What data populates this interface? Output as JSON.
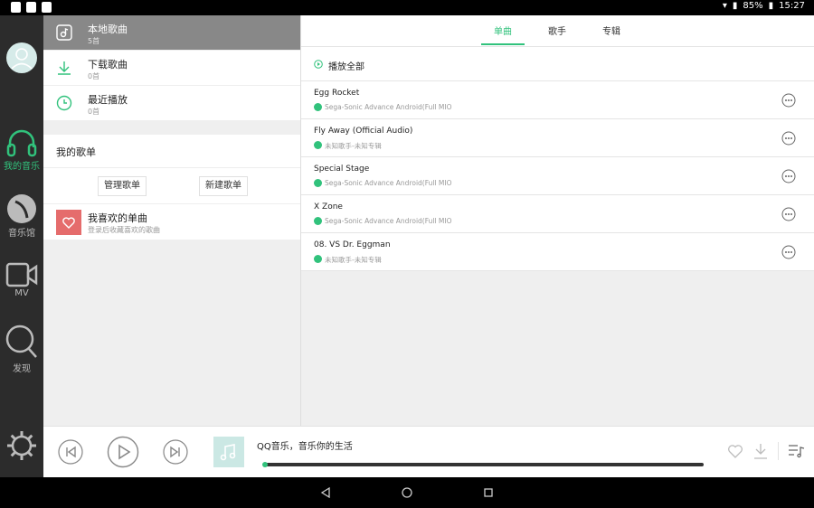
{
  "status": {
    "battery": "85%",
    "time": "15:27"
  },
  "nav": {
    "items": [
      {
        "label": "我的音乐"
      },
      {
        "label": "音乐馆"
      },
      {
        "label": "MV"
      },
      {
        "label": "发现"
      }
    ]
  },
  "library": {
    "items": [
      {
        "title": "本地歌曲",
        "count": "5首"
      },
      {
        "title": "下载歌曲",
        "count": "0首"
      },
      {
        "title": "最近播放",
        "count": "0首"
      }
    ]
  },
  "playlists": {
    "header": "我的歌单",
    "manage_label": "管理歌单",
    "new_label": "新建歌单",
    "favorite_title": "我喜欢的单曲",
    "favorite_subtitle": "登录后收藏喜欢的歌曲"
  },
  "tabs": [
    "单曲",
    "歌手",
    "专辑"
  ],
  "play_all_label": "播放全部",
  "songs": [
    {
      "title": "Egg Rocket",
      "subtitle": "Sega-Sonic Advance Android(Full MIO"
    },
    {
      "title": "Fly Away (Official Audio)",
      "subtitle": "未知歌手-未知专辑"
    },
    {
      "title": "Special Stage",
      "subtitle": "Sega-Sonic Advance Android(Full MIO"
    },
    {
      "title": "X Zone",
      "subtitle": "Sega-Sonic Advance Android(Full MIO"
    },
    {
      "title": "08. VS Dr. Eggman",
      "subtitle": "未知歌手-未知专辑"
    }
  ],
  "player": {
    "title": "QQ音乐，音乐你的生活",
    "progress": 0
  },
  "colors": {
    "accent": "#31c27c",
    "sidebar": "#2c2c2c",
    "favorite": "#e56c6c"
  }
}
